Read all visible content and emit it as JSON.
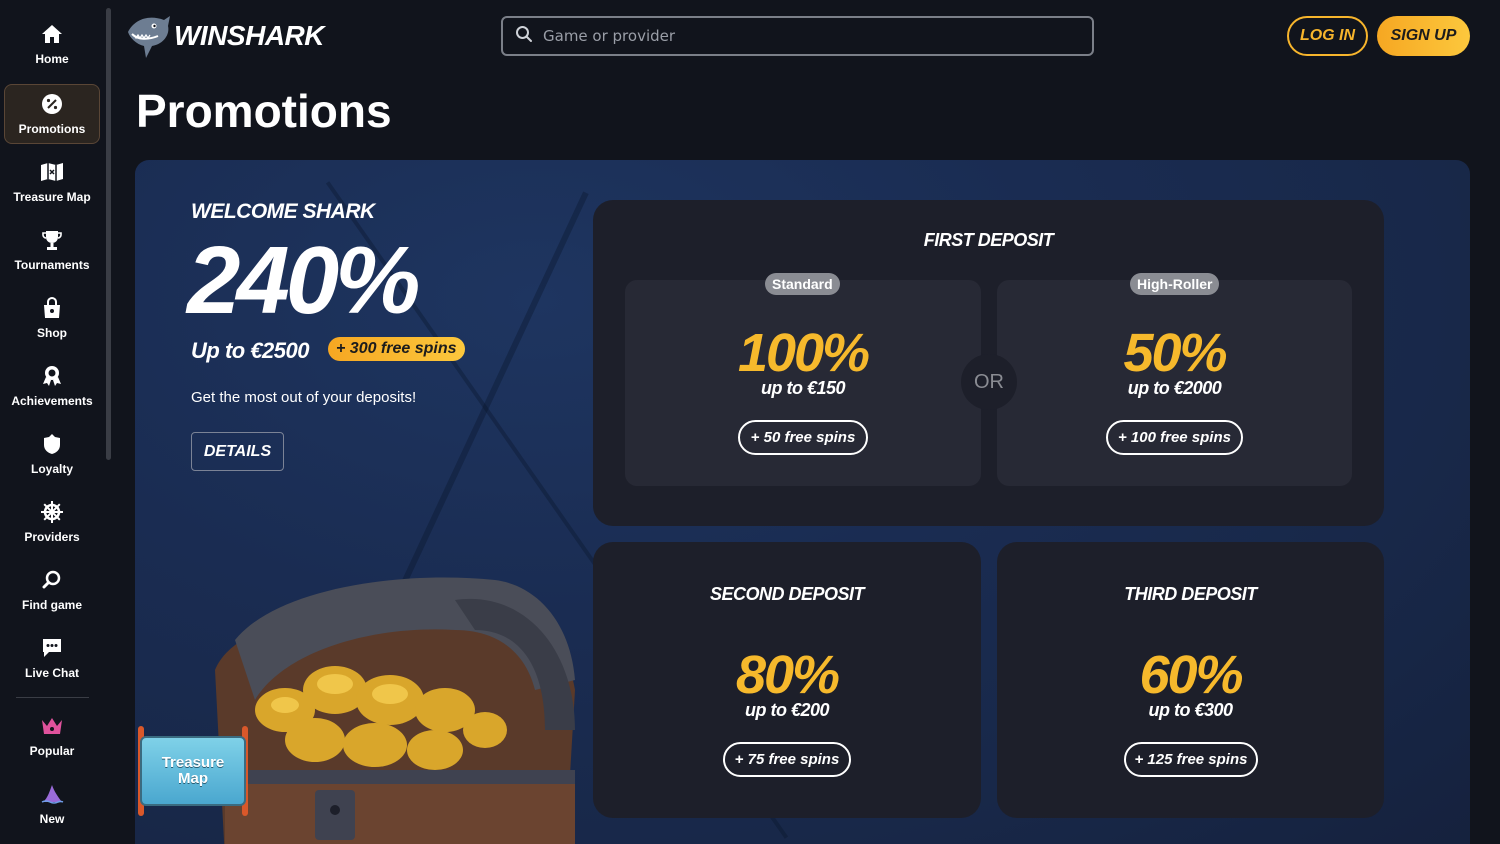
{
  "sidebar": {
    "items": [
      {
        "label": "Home",
        "icon": "home-icon"
      },
      {
        "label": "Promotions",
        "icon": "percent-icon"
      },
      {
        "label": "Treasure Map",
        "icon": "map-icon"
      },
      {
        "label": "Tournaments",
        "icon": "trophy-icon"
      },
      {
        "label": "Shop",
        "icon": "shopping-bag-icon"
      },
      {
        "label": "Achievements",
        "icon": "medal-icon"
      },
      {
        "label": "Loyalty",
        "icon": "gem-icon"
      },
      {
        "label": "Providers",
        "icon": "ship-wheel-icon"
      },
      {
        "label": "Find game",
        "icon": "search-icon"
      },
      {
        "label": "Live Chat",
        "icon": "chat-icon"
      },
      {
        "label": "Popular",
        "icon": "crown-icon"
      },
      {
        "label": "New",
        "icon": "shark-fin-icon"
      }
    ],
    "active": "Promotions"
  },
  "header": {
    "logo": "WINSHARK",
    "search_placeholder": "Game or provider",
    "login": "LOG IN",
    "signup": "SIGN UP"
  },
  "page": {
    "title": "Promotions"
  },
  "hero": {
    "welcome": "WELCOME SHARK",
    "big_percent": "240%",
    "upto": "Up to €2500",
    "free_spins_badge": "+ 300 free spins",
    "tagline": "Get the most out of your deposits!",
    "details": "DETAILS"
  },
  "first_deposit": {
    "title": "FIRST DEPOSIT",
    "or": "OR",
    "standard": {
      "pill": "Standard",
      "percent": "100%",
      "upto": "up to €150",
      "spins": "+ 50 free spins"
    },
    "high_roller": {
      "pill": "High-Roller",
      "percent": "50%",
      "upto": "up to €2000",
      "spins": "+ 100 free spins"
    }
  },
  "second_deposit": {
    "title": "SECOND DEPOSIT",
    "percent": "80%",
    "upto": "up to €200",
    "spins": "+ 75 free spins"
  },
  "third_deposit": {
    "title": "THIRD DEPOSIT",
    "percent": "60%",
    "upto": "up to €300",
    "spins": "+ 125 free spins"
  },
  "treasure_widget": {
    "line1": "Treasure",
    "line2": "Map"
  },
  "colors": {
    "accent": "#f6b92c",
    "background": "#11141c",
    "card": "#1d1f2a",
    "sub_card": "#272935"
  }
}
